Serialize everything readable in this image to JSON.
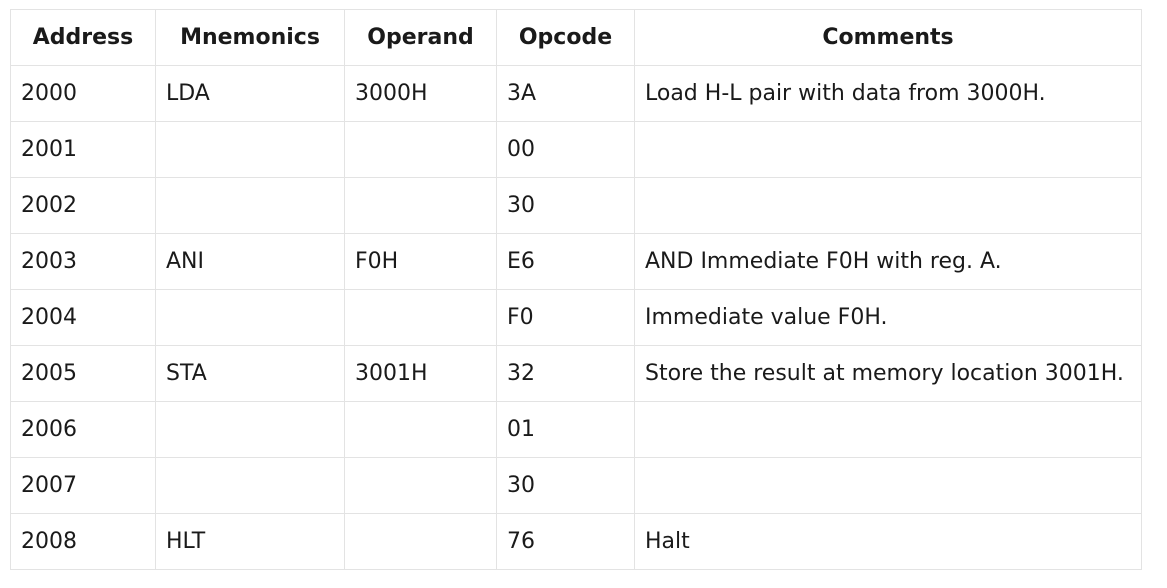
{
  "table": {
    "headers": [
      "Address",
      "Mnemonics",
      "Operand",
      "Opcode",
      "Comments"
    ],
    "rows": [
      [
        "2000",
        "LDA",
        "3000H",
        "3A",
        "Load H-L pair with data from 3000H."
      ],
      [
        "2001",
        "",
        "",
        "00",
        ""
      ],
      [
        "2002",
        "",
        "",
        "30",
        ""
      ],
      [
        "2003",
        "ANI",
        "F0H",
        "E6",
        "AND Immediate F0H with reg. A."
      ],
      [
        "2004",
        "",
        "",
        "F0",
        "Immediate value F0H."
      ],
      [
        "2005",
        "STA",
        "3001H",
        "32",
        "Store the result at memory location 3001H."
      ],
      [
        "2006",
        "",
        "",
        "01",
        ""
      ],
      [
        "2007",
        "",
        "",
        "30",
        ""
      ],
      [
        "2008",
        "HLT",
        "",
        "76",
        "Halt"
      ]
    ]
  },
  "colors": {
    "border": "#e3e3e3",
    "text": "#1a1a1a",
    "background": "#ffffff"
  }
}
